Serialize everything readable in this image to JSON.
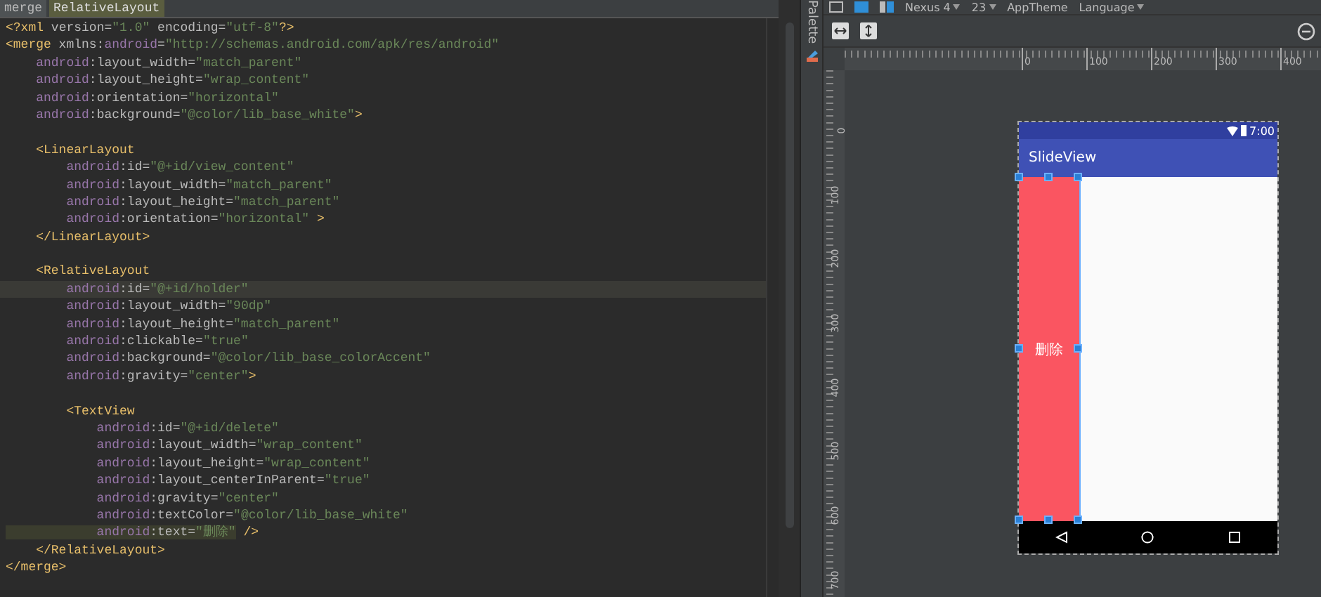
{
  "editor": {
    "breadcrumbs": [
      {
        "label": "merge",
        "selected": false
      },
      {
        "label": "RelativeLayout",
        "selected": true
      }
    ],
    "lines": [
      {
        "current": false,
        "segments": [
          {
            "kind": "tag",
            "text": "<?xml"
          },
          {
            "kind": "attr",
            "text": " version="
          },
          {
            "kind": "value",
            "text": "\"1.0\""
          },
          {
            "kind": "attr",
            "text": " encoding="
          },
          {
            "kind": "value",
            "text": "\"utf-8\""
          },
          {
            "kind": "tag",
            "text": "?>"
          }
        ]
      },
      {
        "current": false,
        "segments": [
          {
            "kind": "tag",
            "text": "<merge"
          },
          {
            "kind": "attr",
            "text": " xmlns:"
          },
          {
            "kind": "ns",
            "text": "android"
          },
          {
            "kind": "attr",
            "text": "="
          },
          {
            "kind": "value",
            "text": "\"http://schemas.android.com/apk/res/android\""
          }
        ]
      },
      {
        "current": false,
        "segments": [
          {
            "kind": "ns",
            "text": "    android"
          },
          {
            "kind": "attr",
            "text": ":layout_width="
          },
          {
            "kind": "value",
            "text": "\"match_parent\""
          }
        ]
      },
      {
        "current": false,
        "segments": [
          {
            "kind": "ns",
            "text": "    android"
          },
          {
            "kind": "attr",
            "text": ":layout_height="
          },
          {
            "kind": "value",
            "text": "\"wrap_content\""
          }
        ]
      },
      {
        "current": false,
        "segments": [
          {
            "kind": "ns",
            "text": "    android"
          },
          {
            "kind": "attr",
            "text": ":orientation="
          },
          {
            "kind": "value",
            "text": "\"horizontal\""
          }
        ]
      },
      {
        "current": false,
        "segments": [
          {
            "kind": "ns",
            "text": "    android"
          },
          {
            "kind": "attr",
            "text": ":background="
          },
          {
            "kind": "value",
            "text": "\"@color/lib_base_white\""
          },
          {
            "kind": "tag",
            "text": ">"
          }
        ]
      },
      {
        "current": false
      },
      {
        "current": false,
        "segments": [
          {
            "kind": "tag",
            "text": "    <LinearLayout"
          }
        ]
      },
      {
        "current": false,
        "segments": [
          {
            "kind": "ns",
            "text": "        android"
          },
          {
            "kind": "attr",
            "text": ":id="
          },
          {
            "kind": "value",
            "text": "\"@+id/view_content\""
          }
        ]
      },
      {
        "current": false,
        "segments": [
          {
            "kind": "ns",
            "text": "        android"
          },
          {
            "kind": "attr",
            "text": ":layout_width="
          },
          {
            "kind": "value",
            "text": "\"match_parent\""
          }
        ]
      },
      {
        "current": false,
        "segments": [
          {
            "kind": "ns",
            "text": "        android"
          },
          {
            "kind": "attr",
            "text": ":layout_height="
          },
          {
            "kind": "value",
            "text": "\"match_parent\""
          }
        ]
      },
      {
        "current": false,
        "segments": [
          {
            "kind": "ns",
            "text": "        android"
          },
          {
            "kind": "attr",
            "text": ":orientation="
          },
          {
            "kind": "value",
            "text": "\"horizontal\""
          },
          {
            "kind": "tag",
            "text": " >"
          }
        ]
      },
      {
        "current": false,
        "segments": [
          {
            "kind": "tag",
            "text": "    </LinearLayout>"
          }
        ]
      },
      {
        "current": false
      },
      {
        "current": false,
        "segments": [
          {
            "kind": "tag",
            "text": "    <RelativeLayout"
          }
        ]
      },
      {
        "current": true,
        "segments": [
          {
            "kind": "ns",
            "text": "        android"
          },
          {
            "kind": "attr",
            "text": ":id="
          },
          {
            "kind": "value",
            "text": "\"@+id/holder\""
          }
        ]
      },
      {
        "current": false,
        "segments": [
          {
            "kind": "ns",
            "text": "        android"
          },
          {
            "kind": "attr",
            "text": ":layout_width="
          },
          {
            "kind": "value",
            "text": "\"90dp\""
          }
        ]
      },
      {
        "current": false,
        "segments": [
          {
            "kind": "ns",
            "text": "        android"
          },
          {
            "kind": "attr",
            "text": ":layout_height="
          },
          {
            "kind": "value",
            "text": "\"match_parent\""
          }
        ]
      },
      {
        "current": false,
        "segments": [
          {
            "kind": "ns",
            "text": "        android"
          },
          {
            "kind": "attr",
            "text": ":clickable="
          },
          {
            "kind": "value",
            "text": "\"true\""
          }
        ]
      },
      {
        "current": false,
        "segments": [
          {
            "kind": "ns",
            "text": "        android"
          },
          {
            "kind": "attr",
            "text": ":background="
          },
          {
            "kind": "value",
            "text": "\"@color/lib_base_colorAccent\""
          }
        ]
      },
      {
        "current": false,
        "segments": [
          {
            "kind": "ns",
            "text": "        android"
          },
          {
            "kind": "attr",
            "text": ":gravity="
          },
          {
            "kind": "value",
            "text": "\"center\""
          },
          {
            "kind": "tag",
            "text": ">"
          }
        ]
      },
      {
        "current": false
      },
      {
        "current": false,
        "segments": [
          {
            "kind": "tag",
            "text": "        <TextView"
          }
        ]
      },
      {
        "current": false,
        "segments": [
          {
            "kind": "ns",
            "text": "            android"
          },
          {
            "kind": "attr",
            "text": ":id="
          },
          {
            "kind": "value",
            "text": "\"@+id/delete\""
          }
        ]
      },
      {
        "current": false,
        "segments": [
          {
            "kind": "ns",
            "text": "            android"
          },
          {
            "kind": "attr",
            "text": ":layout_width="
          },
          {
            "kind": "value",
            "text": "\"wrap_content\""
          }
        ]
      },
      {
        "current": false,
        "segments": [
          {
            "kind": "ns",
            "text": "            android"
          },
          {
            "kind": "attr",
            "text": ":layout_height="
          },
          {
            "kind": "value",
            "text": "\"wrap_content\""
          }
        ]
      },
      {
        "current": false,
        "segments": [
          {
            "kind": "ns",
            "text": "            android"
          },
          {
            "kind": "attr",
            "text": ":layout_centerInParent="
          },
          {
            "kind": "value",
            "text": "\"true\""
          }
        ]
      },
      {
        "current": false,
        "segments": [
          {
            "kind": "ns",
            "text": "            android"
          },
          {
            "kind": "attr",
            "text": ":gravity="
          },
          {
            "kind": "value",
            "text": "\"center\""
          }
        ]
      },
      {
        "current": false,
        "segments": [
          {
            "kind": "ns",
            "text": "            android"
          },
          {
            "kind": "attr",
            "text": ":textColor="
          },
          {
            "kind": "value",
            "text": "\"@color/lib_base_white\""
          }
        ]
      },
      {
        "current": false,
        "segments": [
          {
            "kind": "ns_marked",
            "text": "            android"
          },
          {
            "kind": "attr_marked",
            "text": ":text="
          },
          {
            "kind": "value_marked",
            "text": "\"删除\""
          },
          {
            "kind": "tag",
            "text": " />"
          }
        ]
      },
      {
        "current": false,
        "segments": [
          {
            "kind": "tag",
            "text": "    </RelativeLayout>"
          }
        ]
      },
      {
        "current": false,
        "segments": [
          {
            "kind": "tag",
            "text": "</merge>"
          }
        ]
      }
    ]
  },
  "palette": {
    "label": "Palette"
  },
  "toolbar": {
    "device": "Nexus 4",
    "api": "23",
    "theme": "AppTheme",
    "language": "Language"
  },
  "rulers": {
    "x_labels": [
      "0",
      "100",
      "200",
      "300",
      "400"
    ],
    "y_labels": [
      "0",
      "100",
      "200",
      "300",
      "400",
      "500",
      "600",
      "700"
    ]
  },
  "phone": {
    "time": "7:00",
    "app_title": "SlideView",
    "holder_text": "删除"
  }
}
